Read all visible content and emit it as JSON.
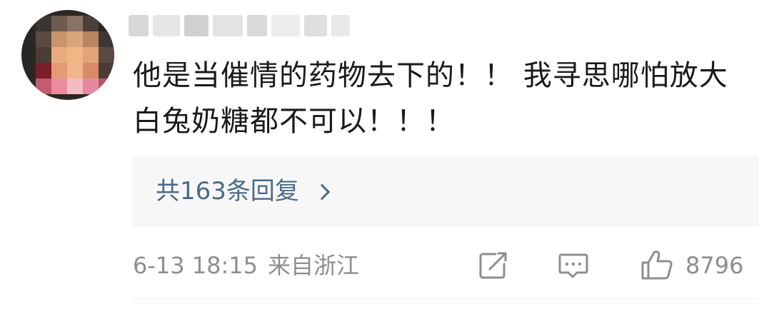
{
  "comment": {
    "text": "他是当催情的药物去下的！！ 我寻思哪怕放大白兔奶糖都不可以！！！",
    "replies_label": "共163条回复",
    "date": "6-13 18:15",
    "location": "来自浙江",
    "like_count": "8796"
  },
  "icons": {
    "share": "share-icon",
    "reply": "comment-icon",
    "like": "thumbs-up-icon",
    "chevron": "chevron-right-icon"
  },
  "colors": {
    "text": "#1a1a1a",
    "link": "#4a6b8a",
    "meta": "#8e8e8e",
    "reply_bg": "#f7f7f7"
  }
}
